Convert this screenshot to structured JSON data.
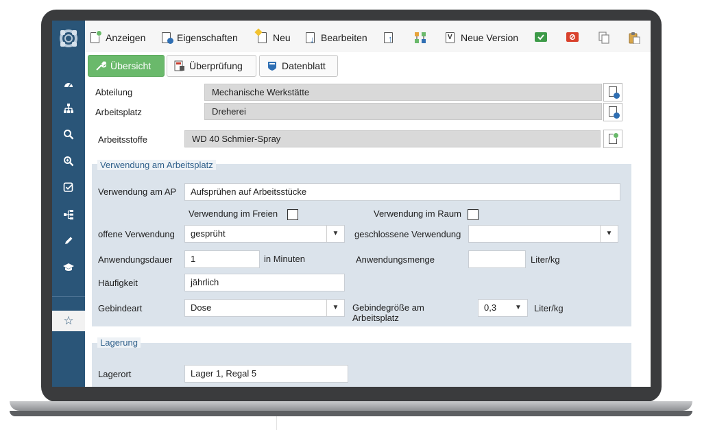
{
  "toolbar": {
    "anzeigen": "Anzeigen",
    "eigenschaften": "Eigenschaften",
    "neu": "Neu",
    "bearbeiten": "Bearbeiten",
    "neue_version": "Neue Version"
  },
  "tabs": {
    "uebersicht": "Übersicht",
    "ueberpruefung": "Überprüfung",
    "datenblatt": "Datenblatt"
  },
  "header": {
    "abteilung_label": "Abteilung",
    "abteilung_value": "Mechanische Werkstätte",
    "arbeitsplatz_label": "Arbeitsplatz",
    "arbeitsplatz_value": "Dreherei",
    "arbeitsstoffe_label": "Arbeitsstoffe",
    "arbeitsstoffe_value": "WD 40 Schmier-Spray"
  },
  "verwendung": {
    "title": "Verwendung am Arbeitsplatz",
    "verwendung_ap_label": "Verwendung am AP",
    "verwendung_ap_value": "Aufsprühen auf Arbeitsstücke",
    "freien_label": "Verwendung im Freien",
    "raum_label": "Verwendung im Raum",
    "offene_label": "offene Verwendung",
    "offene_value": "gesprüht",
    "geschlossene_label": "geschlossene Verwendung",
    "geschlossene_value": "",
    "dauer_label": "Anwendungsdauer",
    "dauer_value": "1",
    "dauer_unit": "in Minuten",
    "menge_label": "Anwendungsmenge",
    "menge_value": "",
    "menge_unit": "Liter/kg",
    "haeufigkeit_label": "Häufigkeit",
    "haeufigkeit_value": "jährlich",
    "gebindeart_label": "Gebindeart",
    "gebindeart_value": "Dose",
    "gebindegroesse_label": "Gebindegröße am Arbeitsplatz",
    "gebindegroesse_value": "0,3",
    "gebindegroesse_unit": "Liter/kg"
  },
  "lagerung": {
    "title": "Lagerung",
    "lagerort_label": "Lagerort",
    "lagerort_value": "Lager 1, Regal 5"
  },
  "colors": {
    "sidebar": "#2a5578",
    "active_tab": "#6ab96b",
    "panel": "#dbe3eb",
    "section_title": "#2e5f8a"
  },
  "icons": {
    "sidebar": [
      "dashboard-icon",
      "sitemap-icon",
      "search-icon",
      "zoom-in-icon",
      "checklist-icon",
      "hierarchy-icon",
      "pencil-icon",
      "graduation-cap-icon",
      "star-icon"
    ]
  }
}
